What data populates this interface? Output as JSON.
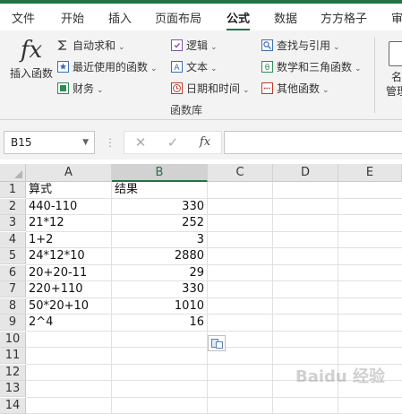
{
  "tabs": [
    {
      "label": "文件",
      "active": false
    },
    {
      "label": "开始",
      "active": false
    },
    {
      "label": "插入",
      "active": false
    },
    {
      "label": "页面布局",
      "active": false
    },
    {
      "label": "公式",
      "active": true
    },
    {
      "label": "数据",
      "active": false
    },
    {
      "label": "方方格子",
      "active": false
    },
    {
      "label": "审",
      "active": false
    }
  ],
  "ribbon": {
    "insert_function": {
      "glyph": "fx",
      "label": "插入函数"
    },
    "col1": [
      {
        "label": "自动求和",
        "icon": "sum-icon"
      },
      {
        "label": "最近使用的函数",
        "icon": "star-icon"
      },
      {
        "label": "财务",
        "icon": "finance-book-icon"
      }
    ],
    "col2": [
      {
        "label": "逻辑",
        "icon": "logic-book-icon"
      },
      {
        "label": "文本",
        "icon": "text-icon"
      },
      {
        "label": "日期和时间",
        "icon": "clock-icon"
      }
    ],
    "col3": [
      {
        "label": "查找与引用",
        "icon": "lookup-icon"
      },
      {
        "label": "数学和三角函数",
        "icon": "math-icon"
      },
      {
        "label": "其他函数",
        "icon": "more-functions-icon"
      }
    ],
    "group_label": "函数库",
    "name_manager": {
      "line1": "名",
      "line2": "管理"
    }
  },
  "formula_bar": {
    "name_box": "B15",
    "fx_label": "fx",
    "formula": ""
  },
  "columns": [
    "A",
    "B",
    "C",
    "D",
    "E"
  ],
  "selected_column": "B",
  "rows": [
    "1",
    "2",
    "3",
    "4",
    "5",
    "6",
    "7",
    "8",
    "9",
    "10",
    "11",
    "12",
    "13",
    "14"
  ],
  "cells": {
    "A": [
      "算式",
      "440-110",
      "21*12",
      "1+2",
      "24*12*10",
      "20+20-11",
      "220+110",
      "50*20+10",
      "2^4"
    ],
    "B": [
      "结果",
      "330",
      "252",
      "3",
      "2880",
      "29",
      "330",
      "1010",
      "16"
    ]
  },
  "watermark": "Baidu 经验"
}
